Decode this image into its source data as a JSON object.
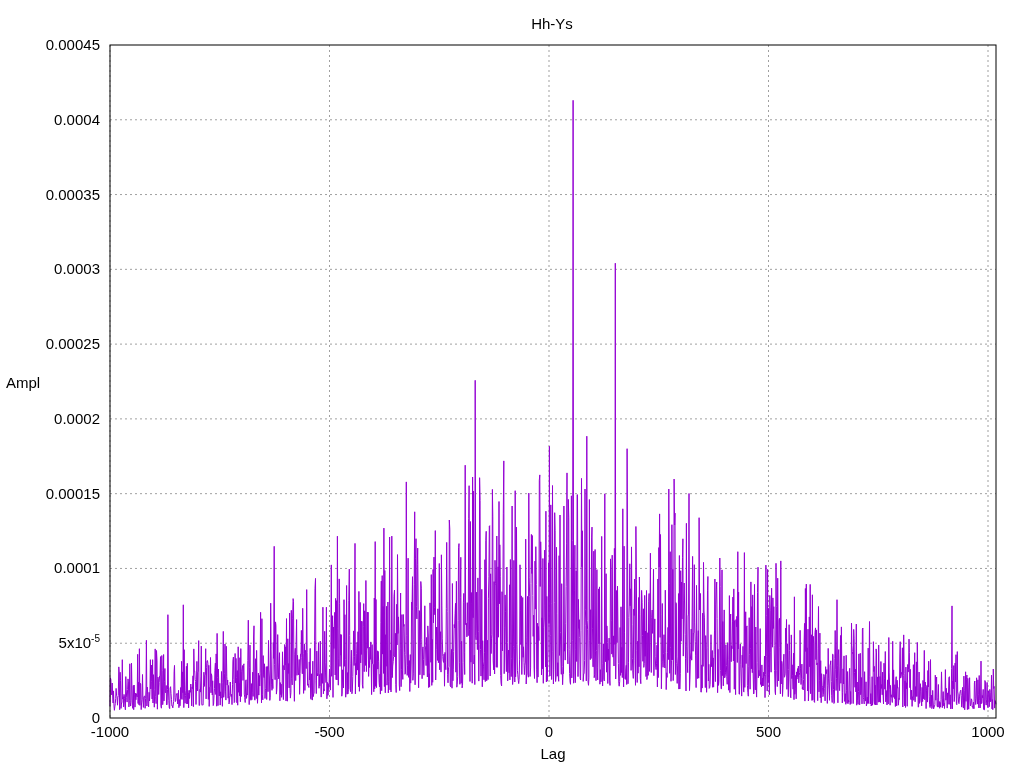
{
  "plot": {
    "title": "Hh-Ys",
    "xlabel": "Lag",
    "ylabel": "Ampl",
    "xtick_labels": [
      "-1000",
      "-500",
      "0",
      "500",
      "1000"
    ],
    "ytick_labels": [
      "0.00045",
      "0.0004",
      "0.00035",
      "0.0003",
      "0.00025",
      "0.0002",
      "0.00015",
      "0.0001",
      "5x10$^{-5}$",
      "0"
    ]
  }
}
